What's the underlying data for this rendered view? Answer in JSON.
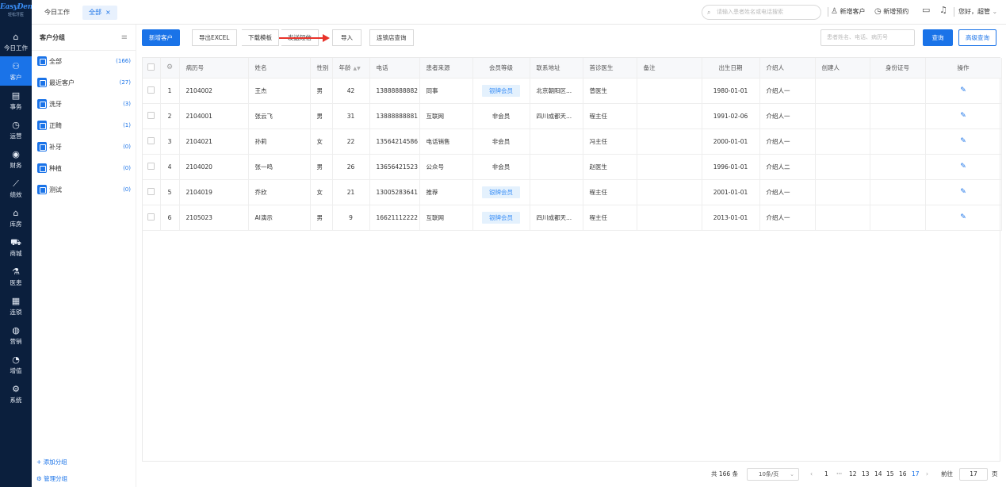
{
  "logo": {
    "line1": "EasyDent",
    "line2": "轻松牙医"
  },
  "nav": [
    {
      "icon": "⌂",
      "label": "今日工作"
    },
    {
      "icon": "⚇",
      "label": "客户"
    },
    {
      "icon": "▤",
      "label": "事务"
    },
    {
      "icon": "◷",
      "label": "运营"
    },
    {
      "icon": "◉",
      "label": "财务"
    },
    {
      "icon": "⟋",
      "label": "绩效"
    },
    {
      "icon": "⌂",
      "label": "库房"
    },
    {
      "icon": "⛟",
      "label": "商城"
    },
    {
      "icon": "⚗",
      "label": "医患"
    },
    {
      "icon": "▦",
      "label": "连锁"
    },
    {
      "icon": "◍",
      "label": "营销"
    },
    {
      "icon": "◔",
      "label": "增值"
    },
    {
      "icon": "⚙",
      "label": "系统"
    }
  ],
  "topbar": {
    "tab_today": "今日工作",
    "tab_all": "全部",
    "tab_close": "×",
    "search_placeholder": "请输入患者姓名或电话搜索",
    "new_customer": "新增客户",
    "new_appointment": "新增预约",
    "greeting": "您好，超管"
  },
  "groups": {
    "title": "客户分组",
    "items": [
      {
        "label": "全部",
        "count": "(166)"
      },
      {
        "label": "最近客户",
        "count": "(27)"
      },
      {
        "label": "洗牙",
        "count": "(3)"
      },
      {
        "label": "正畸",
        "count": "(1)"
      },
      {
        "label": "补牙",
        "count": "(0)"
      },
      {
        "label": "种植",
        "count": "(0)"
      },
      {
        "label": "测试",
        "count": "(0)"
      }
    ],
    "add_group": "+ 添加分组",
    "manage_group": "⚙ 管理分组"
  },
  "toolbar": {
    "new_customer": "新增客户",
    "export_excel": "导出EXCEL",
    "download_template": "下载模板",
    "send_sms": "发送短信",
    "import": "导入",
    "chain_query": "连锁店查询",
    "search_placeholder": "患者姓名、电话、病历号",
    "query": "查询",
    "advanced_query": "高级查询"
  },
  "table": {
    "headers": [
      "",
      "⚙",
      "病历号",
      "姓名",
      "性别",
      "年龄",
      "电话",
      "患者来源",
      "会员等级",
      "联系地址",
      "首诊医生",
      "备注",
      "出生日期",
      "介绍人",
      "创建人",
      "身份证号",
      "操作"
    ],
    "rows": [
      {
        "idx": "1",
        "record": "2104002",
        "name": "王杰",
        "gender": "男",
        "age": "42",
        "phone": "13888888882",
        "source": "同事",
        "level": "银牌会员",
        "level_tag": true,
        "address": "北京朝阳区...",
        "doctor": "曾医生",
        "note": "",
        "birth": "1980-01-01",
        "referrer": "介绍人一",
        "creator": "",
        "idcard": ""
      },
      {
        "idx": "2",
        "record": "2104001",
        "name": "张云飞",
        "gender": "男",
        "age": "31",
        "phone": "13888888881",
        "source": "互联网",
        "level": "非会员",
        "level_tag": false,
        "address": "四川成都天...",
        "doctor": "程主任",
        "note": "",
        "birth": "1991-02-06",
        "referrer": "介绍人一",
        "creator": "",
        "idcard": ""
      },
      {
        "idx": "3",
        "record": "2104021",
        "name": "孙莉",
        "gender": "女",
        "age": "22",
        "phone": "13564214586",
        "source": "电话销售",
        "level": "非会员",
        "level_tag": false,
        "address": "",
        "doctor": "冯主任",
        "note": "",
        "birth": "2000-01-01",
        "referrer": "介绍人一",
        "creator": "",
        "idcard": ""
      },
      {
        "idx": "4",
        "record": "2104020",
        "name": "张一鸣",
        "gender": "男",
        "age": "26",
        "phone": "13656421523",
        "source": "公众号",
        "level": "非会员",
        "level_tag": false,
        "address": "",
        "doctor": "赵医生",
        "note": "",
        "birth": "1996-01-01",
        "referrer": "介绍人二",
        "creator": "",
        "idcard": ""
      },
      {
        "idx": "5",
        "record": "2104019",
        "name": "乔欣",
        "gender": "女",
        "age": "21",
        "phone": "13005283641",
        "source": "推荐",
        "level": "银牌会员",
        "level_tag": true,
        "address": "",
        "doctor": "程主任",
        "note": "",
        "birth": "2001-01-01",
        "referrer": "介绍人一",
        "creator": "",
        "idcard": ""
      },
      {
        "idx": "6",
        "record": "2105023",
        "name": "AI演示",
        "gender": "男",
        "age": "9",
        "phone": "16621112222",
        "source": "互联网",
        "level": "银牌会员",
        "level_tag": true,
        "address": "四川成都天...",
        "doctor": "程主任",
        "note": "",
        "birth": "2013-01-01",
        "referrer": "介绍人一",
        "creator": "",
        "idcard": ""
      }
    ]
  },
  "pager": {
    "total": "共 166 条",
    "page_size": "10条/页",
    "prev": "‹",
    "pages": [
      "1",
      "···",
      "12",
      "13",
      "14",
      "15",
      "16",
      "17"
    ],
    "active_page": "17",
    "next": "›",
    "goto_label": "前往",
    "goto_value": "17",
    "page_unit": "页"
  },
  "colors": {
    "accent": "#1a73e8",
    "nav_bg": "#0b1f3d",
    "annotation_arrow": "#e8332a"
  }
}
